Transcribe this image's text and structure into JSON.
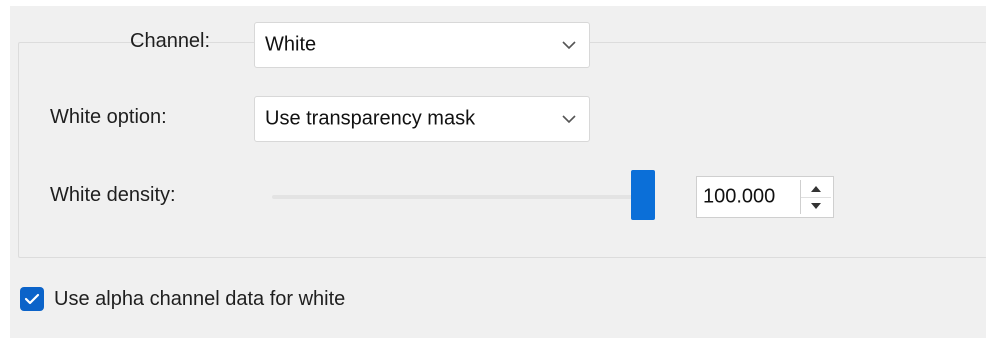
{
  "channel": {
    "label": "Channel:",
    "value": "White"
  },
  "white_option": {
    "label": "White option:",
    "value": "Use transparency mask"
  },
  "white_density": {
    "label": "White density:",
    "slider_fraction": 1.0,
    "value": "100.000"
  },
  "alpha_checkbox": {
    "label": "Use alpha channel data for white",
    "checked": true
  },
  "colors": {
    "accent": "#0b6fd8",
    "panel": "#f0f0f0"
  },
  "icons": {
    "dropdown": "chevron-down-icon",
    "spin_up": "arrow-up-icon",
    "spin_down": "arrow-down-icon",
    "check": "checkmark-icon"
  }
}
